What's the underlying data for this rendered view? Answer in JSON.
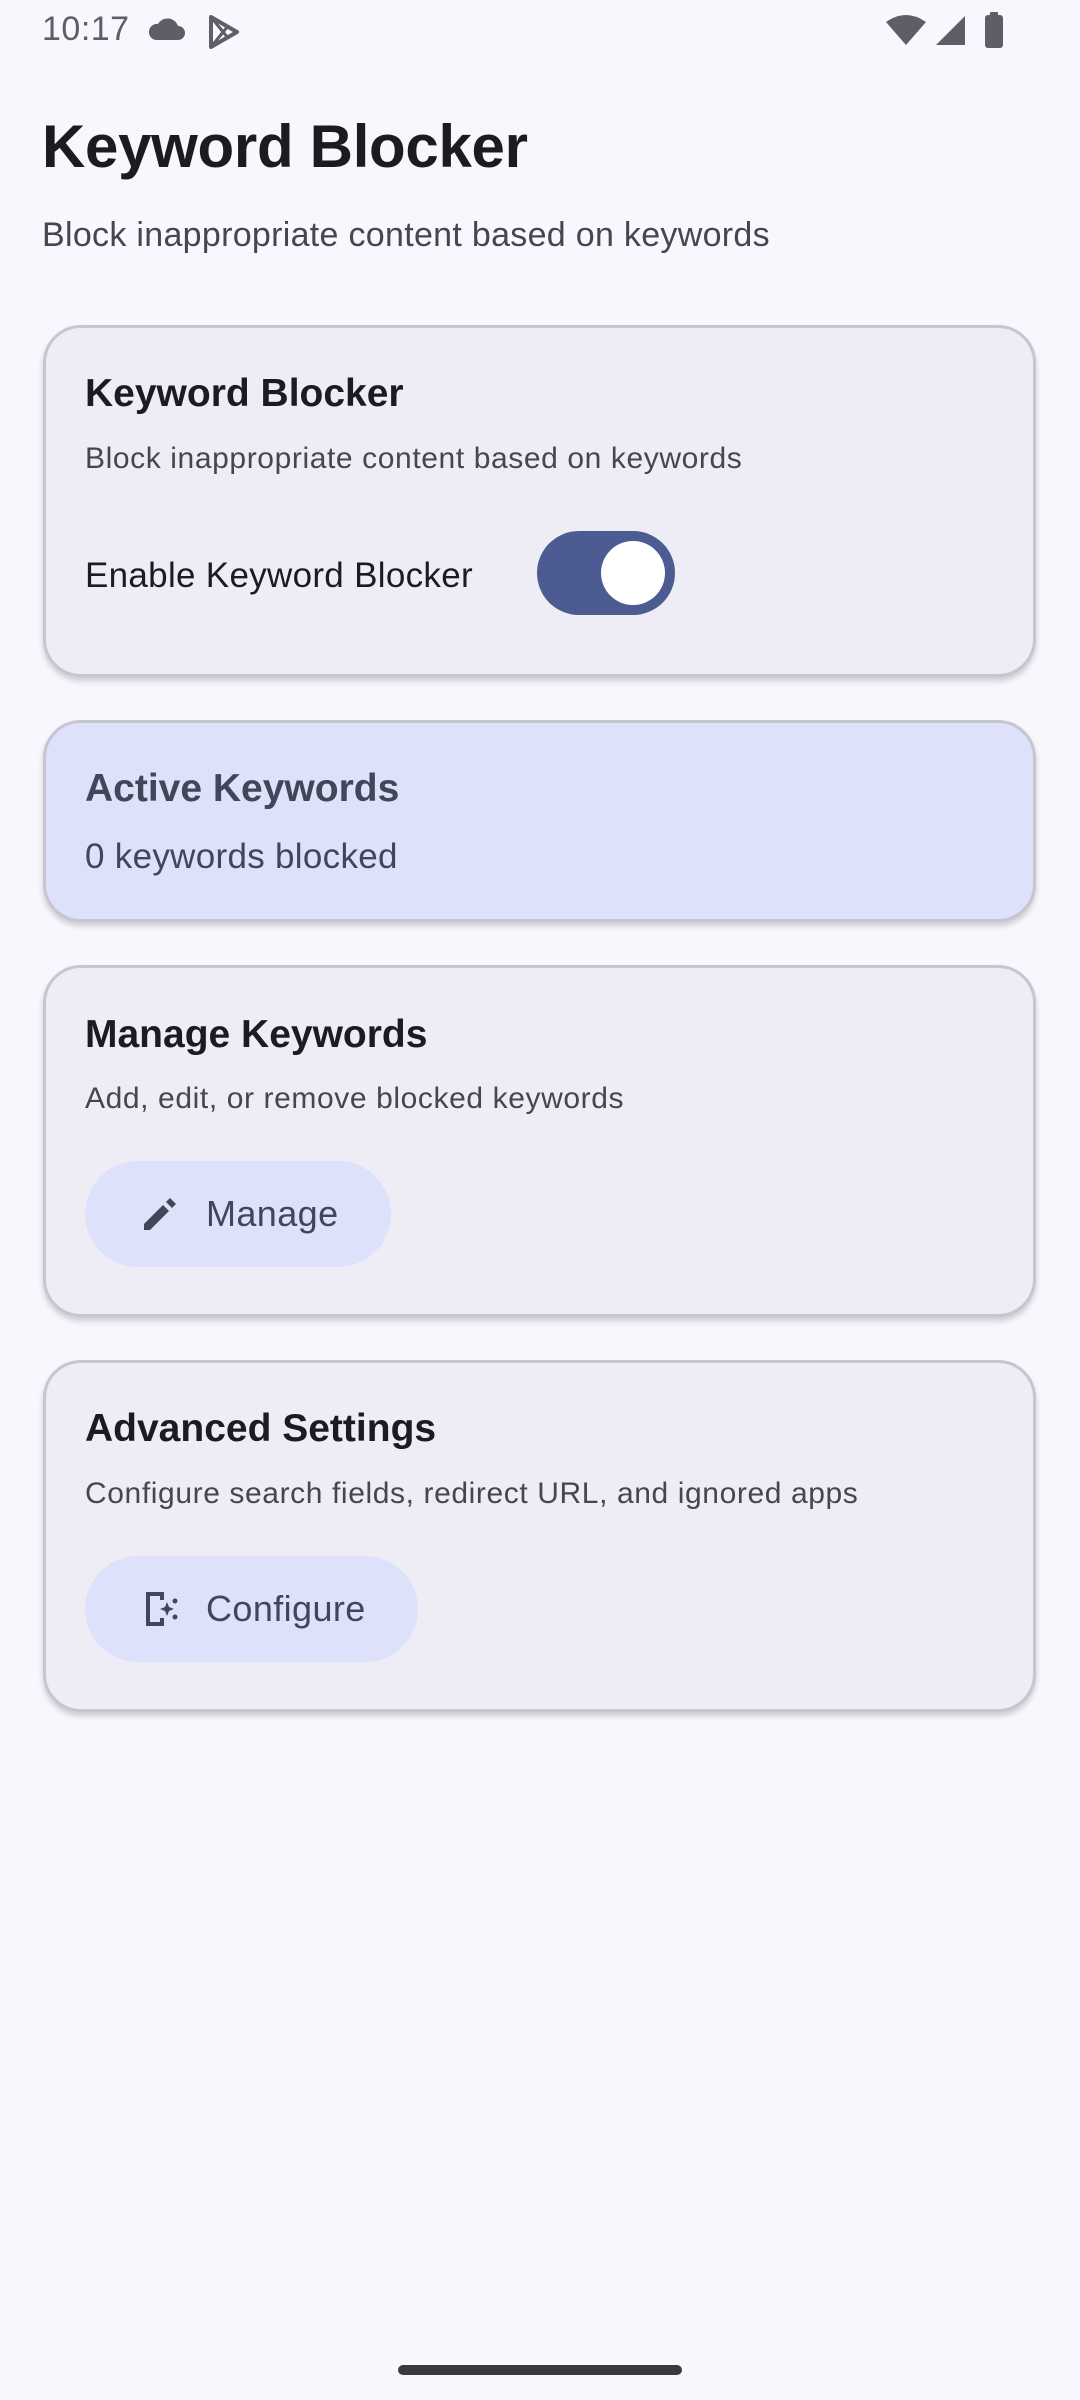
{
  "status_bar": {
    "time": "10:17",
    "left_icons": [
      "cloud-icon",
      "play-store-icon"
    ],
    "right_icons": [
      "wifi-icon",
      "cellular-signal-icon",
      "battery-icon"
    ]
  },
  "header": {
    "title": "Keyword Blocker",
    "subtitle": "Block inappropriate content based on keywords"
  },
  "cards": {
    "blocker": {
      "title": "Keyword Blocker",
      "description": "Block inappropriate content based on keywords",
      "toggle_label": "Enable Keyword Blocker",
      "toggle_on": true
    },
    "active": {
      "title": "Active Keywords",
      "count_text": "0 keywords blocked"
    },
    "manage": {
      "title": "Manage Keywords",
      "description": "Add, edit, or remove blocked keywords",
      "button_label": "Manage",
      "button_icon": "pencil-icon"
    },
    "advanced": {
      "title": "Advanced Settings",
      "description": "Configure search fields, redirect URL, and ignored apps",
      "button_label": "Configure",
      "button_icon": "app-settings-icon"
    }
  },
  "colors": {
    "background": "#f8f7fd",
    "card": "#eeedf6",
    "card_highlight": "#dde1f9",
    "toggle_on": "#4c5c92",
    "on_container": "#434659"
  }
}
